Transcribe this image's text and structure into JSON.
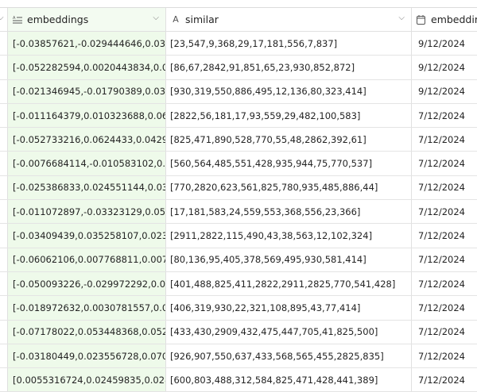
{
  "columns": [
    {
      "label": "embeddings",
      "icon": "text-lines-icon"
    },
    {
      "label": "similar",
      "icon": "text-a-icon"
    },
    {
      "label": "embeddin",
      "icon": "calendar-icon"
    }
  ],
  "rows": [
    {
      "embeddings": "[-0.03857621,-0.029444646,0.03...",
      "similar": "[23,547,9,368,29,17,181,556,7,837]",
      "date": "9/12/2024"
    },
    {
      "embeddings": "[-0.052282594,0.0020443834,0.0...",
      "similar": "[86,67,2842,91,851,65,23,930,852,872]",
      "date": "9/12/2024"
    },
    {
      "embeddings": "[-0.021346945,-0.01790389,0.03...",
      "similar": "[930,319,550,886,495,12,136,80,323,414]",
      "date": "9/12/2024"
    },
    {
      "embeddings": "[-0.011164379,0.010323688,0.06...",
      "similar": "[2822,56,181,17,93,559,29,482,100,583]",
      "date": "7/12/2024"
    },
    {
      "embeddings": "[-0.052733216,0.0624433,0.0429...",
      "similar": "[825,471,890,528,770,55,48,2862,392,61]",
      "date": "7/12/2024"
    },
    {
      "embeddings": "[-0.0076684114,-0.010583102,0....",
      "similar": "[560,564,485,551,428,935,944,75,770,537]",
      "date": "7/12/2024"
    },
    {
      "embeddings": "[-0.025386833,0.024551144,0.03...",
      "similar": "[770,2820,623,561,825,780,935,485,886,44]",
      "date": "7/12/2024"
    },
    {
      "embeddings": "[-0.011072897,-0.03323129,0.05...",
      "similar": "[17,181,583,24,559,553,368,556,23,366]",
      "date": "7/12/2024"
    },
    {
      "embeddings": "[-0.03409439,0.035258107,0.023...",
      "similar": "[2911,2822,115,490,43,38,563,12,102,324]",
      "date": "7/12/2024"
    },
    {
      "embeddings": "[-0.06062106,0.007768811,0.007...",
      "similar": "[80,136,95,405,378,569,495,930,581,414]",
      "date": "7/12/2024"
    },
    {
      "embeddings": "[-0.050093226,-0.029972292,0.0...",
      "similar": "[401,488,825,411,2822,2911,2825,770,541,428]",
      "date": "7/12/2024"
    },
    {
      "embeddings": "[-0.018972632,0.0030781557,0.0...",
      "similar": "[406,319,930,22,321,108,895,43,77,414]",
      "date": "7/12/2024"
    },
    {
      "embeddings": "[-0.07178022,0.053448368,0.052...",
      "similar": "[433,430,2909,432,475,447,705,41,825,500]",
      "date": "7/12/2024"
    },
    {
      "embeddings": "[-0.03180449,0.023556728,0.070...",
      "similar": "[926,907,550,637,433,568,565,455,2825,835]",
      "date": "7/12/2024"
    },
    {
      "embeddings": "[0.0055316724,0.02459835,0.028...",
      "similar": "[600,803,488,312,584,825,471,428,441,389]",
      "date": "7/12/2024"
    }
  ],
  "colors": {
    "selected_column_bg": "#eefaea",
    "grid_line": "#e4e4e4"
  }
}
